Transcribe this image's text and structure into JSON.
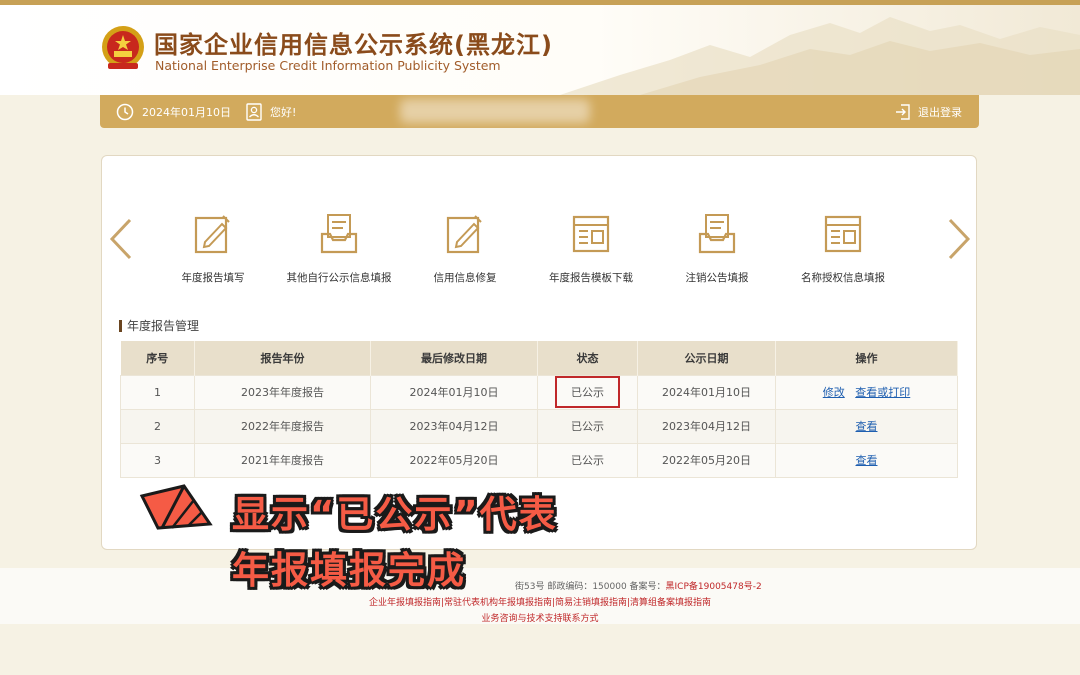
{
  "header": {
    "title_cn": "国家企业信用信息公示系统(黑龙江)",
    "title_en": "National Enterprise Credit Information Publicity System"
  },
  "userbar": {
    "date": "2024年01月10日",
    "greeting": "您好!",
    "logout": "退出登录"
  },
  "functions": [
    {
      "label": "年度报告填写",
      "icon": "edit-form-icon"
    },
    {
      "label": "其他自行公示信息填报",
      "icon": "inbox-document-icon"
    },
    {
      "label": "信用信息修复",
      "icon": "edit-form-icon"
    },
    {
      "label": "年度报告模板下载",
      "icon": "template-card-icon"
    },
    {
      "label": "注销公告填报",
      "icon": "inbox-document-icon"
    },
    {
      "label": "名称授权信息填报",
      "icon": "template-card-icon"
    }
  ],
  "section": {
    "title": "年度报告管理"
  },
  "table": {
    "headers": [
      "序号",
      "报告年份",
      "最后修改日期",
      "状态",
      "公示日期",
      "操作"
    ],
    "rows": [
      {
        "no": "1",
        "year": "2023年年度报告",
        "modified": "2024年01月10日",
        "status": "已公示",
        "published": "2024年01月10日",
        "action1": "修改",
        "action2": "查看或打印"
      },
      {
        "no": "2",
        "year": "2022年年度报告",
        "modified": "2023年04月12日",
        "status": "已公示",
        "published": "2023年04月12日",
        "action1": "查看"
      },
      {
        "no": "3",
        "year": "2021年年度报告",
        "modified": "2022年05月20日",
        "status": "已公示",
        "published": "2022年05月20日",
        "action1": "查看"
      }
    ]
  },
  "footer": {
    "line1_a": "街53号 邮政编码：150000 备案号：",
    "line1_icp": "黑ICP备19005478号-2",
    "line2": "企业年报填报指南|常驻代表机构年报填报指南|简易注销填报指南|清算组备案填报指南",
    "line3": "业务咨询与技术支持联系方式"
  },
  "annotation": {
    "line1": "显示“已公示”代表",
    "line2": "年报填报完成"
  },
  "colors": {
    "gold": "#d2aa5d",
    "brown": "#8a4b1b",
    "highlight_red": "#c0282a",
    "annotation_red": "#f55b45",
    "link_blue": "#1f5fb0"
  }
}
